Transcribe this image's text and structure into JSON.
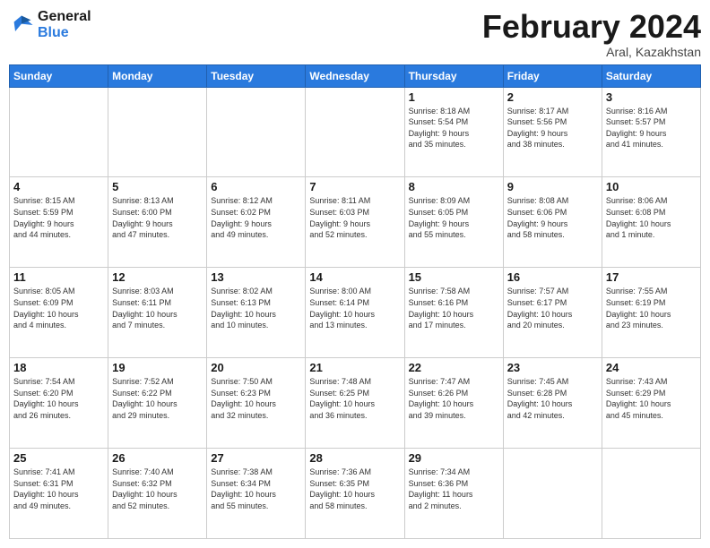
{
  "header": {
    "logo_line1": "General",
    "logo_line2": "Blue",
    "month_title": "February 2024",
    "location": "Aral, Kazakhstan"
  },
  "weekdays": [
    "Sunday",
    "Monday",
    "Tuesday",
    "Wednesday",
    "Thursday",
    "Friday",
    "Saturday"
  ],
  "weeks": [
    [
      {
        "day": "",
        "info": ""
      },
      {
        "day": "",
        "info": ""
      },
      {
        "day": "",
        "info": ""
      },
      {
        "day": "",
        "info": ""
      },
      {
        "day": "1",
        "info": "Sunrise: 8:18 AM\nSunset: 5:54 PM\nDaylight: 9 hours\nand 35 minutes."
      },
      {
        "day": "2",
        "info": "Sunrise: 8:17 AM\nSunset: 5:56 PM\nDaylight: 9 hours\nand 38 minutes."
      },
      {
        "day": "3",
        "info": "Sunrise: 8:16 AM\nSunset: 5:57 PM\nDaylight: 9 hours\nand 41 minutes."
      }
    ],
    [
      {
        "day": "4",
        "info": "Sunrise: 8:15 AM\nSunset: 5:59 PM\nDaylight: 9 hours\nand 44 minutes."
      },
      {
        "day": "5",
        "info": "Sunrise: 8:13 AM\nSunset: 6:00 PM\nDaylight: 9 hours\nand 47 minutes."
      },
      {
        "day": "6",
        "info": "Sunrise: 8:12 AM\nSunset: 6:02 PM\nDaylight: 9 hours\nand 49 minutes."
      },
      {
        "day": "7",
        "info": "Sunrise: 8:11 AM\nSunset: 6:03 PM\nDaylight: 9 hours\nand 52 minutes."
      },
      {
        "day": "8",
        "info": "Sunrise: 8:09 AM\nSunset: 6:05 PM\nDaylight: 9 hours\nand 55 minutes."
      },
      {
        "day": "9",
        "info": "Sunrise: 8:08 AM\nSunset: 6:06 PM\nDaylight: 9 hours\nand 58 minutes."
      },
      {
        "day": "10",
        "info": "Sunrise: 8:06 AM\nSunset: 6:08 PM\nDaylight: 10 hours\nand 1 minute."
      }
    ],
    [
      {
        "day": "11",
        "info": "Sunrise: 8:05 AM\nSunset: 6:09 PM\nDaylight: 10 hours\nand 4 minutes."
      },
      {
        "day": "12",
        "info": "Sunrise: 8:03 AM\nSunset: 6:11 PM\nDaylight: 10 hours\nand 7 minutes."
      },
      {
        "day": "13",
        "info": "Sunrise: 8:02 AM\nSunset: 6:13 PM\nDaylight: 10 hours\nand 10 minutes."
      },
      {
        "day": "14",
        "info": "Sunrise: 8:00 AM\nSunset: 6:14 PM\nDaylight: 10 hours\nand 13 minutes."
      },
      {
        "day": "15",
        "info": "Sunrise: 7:58 AM\nSunset: 6:16 PM\nDaylight: 10 hours\nand 17 minutes."
      },
      {
        "day": "16",
        "info": "Sunrise: 7:57 AM\nSunset: 6:17 PM\nDaylight: 10 hours\nand 20 minutes."
      },
      {
        "day": "17",
        "info": "Sunrise: 7:55 AM\nSunset: 6:19 PM\nDaylight: 10 hours\nand 23 minutes."
      }
    ],
    [
      {
        "day": "18",
        "info": "Sunrise: 7:54 AM\nSunset: 6:20 PM\nDaylight: 10 hours\nand 26 minutes."
      },
      {
        "day": "19",
        "info": "Sunrise: 7:52 AM\nSunset: 6:22 PM\nDaylight: 10 hours\nand 29 minutes."
      },
      {
        "day": "20",
        "info": "Sunrise: 7:50 AM\nSunset: 6:23 PM\nDaylight: 10 hours\nand 32 minutes."
      },
      {
        "day": "21",
        "info": "Sunrise: 7:48 AM\nSunset: 6:25 PM\nDaylight: 10 hours\nand 36 minutes."
      },
      {
        "day": "22",
        "info": "Sunrise: 7:47 AM\nSunset: 6:26 PM\nDaylight: 10 hours\nand 39 minutes."
      },
      {
        "day": "23",
        "info": "Sunrise: 7:45 AM\nSunset: 6:28 PM\nDaylight: 10 hours\nand 42 minutes."
      },
      {
        "day": "24",
        "info": "Sunrise: 7:43 AM\nSunset: 6:29 PM\nDaylight: 10 hours\nand 45 minutes."
      }
    ],
    [
      {
        "day": "25",
        "info": "Sunrise: 7:41 AM\nSunset: 6:31 PM\nDaylight: 10 hours\nand 49 minutes."
      },
      {
        "day": "26",
        "info": "Sunrise: 7:40 AM\nSunset: 6:32 PM\nDaylight: 10 hours\nand 52 minutes."
      },
      {
        "day": "27",
        "info": "Sunrise: 7:38 AM\nSunset: 6:34 PM\nDaylight: 10 hours\nand 55 minutes."
      },
      {
        "day": "28",
        "info": "Sunrise: 7:36 AM\nSunset: 6:35 PM\nDaylight: 10 hours\nand 58 minutes."
      },
      {
        "day": "29",
        "info": "Sunrise: 7:34 AM\nSunset: 6:36 PM\nDaylight: 11 hours\nand 2 minutes."
      },
      {
        "day": "",
        "info": ""
      },
      {
        "day": "",
        "info": ""
      }
    ]
  ]
}
